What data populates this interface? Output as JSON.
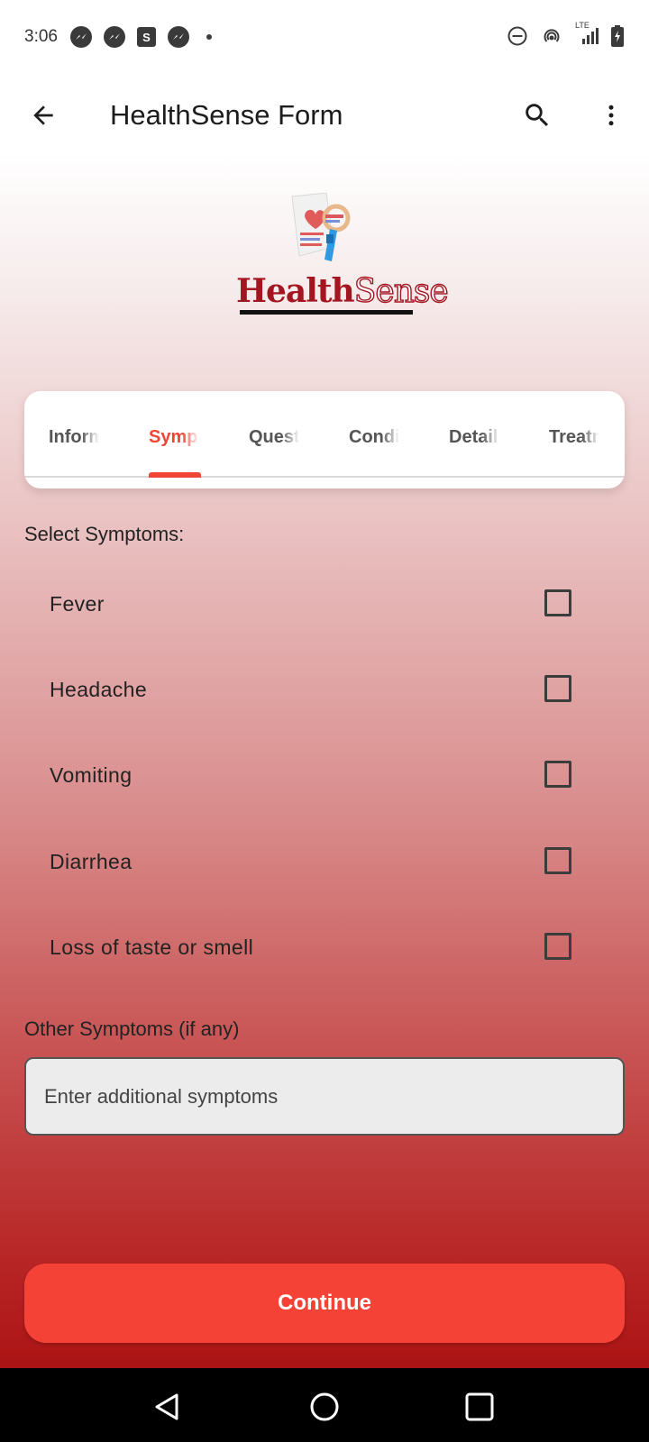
{
  "status_bar": {
    "time": "3:06",
    "left_icons": [
      "messenger-icon",
      "messenger-icon",
      "shopping-bag-icon",
      "messenger-icon",
      "dot-icon"
    ],
    "network_label": "LTE",
    "right_icons": [
      "do-not-disturb-icon",
      "hotspot-icon",
      "signal-icon",
      "battery-charging-icon"
    ]
  },
  "app_bar": {
    "title": "HealthSense Form",
    "back_icon": "arrow-back-icon",
    "search_icon": "search-icon",
    "menu_icon": "more-vert-icon"
  },
  "logo": {
    "word_part1": "Health",
    "word_part2": "Sense"
  },
  "tabs": {
    "items": [
      {
        "label": "Information",
        "active": false
      },
      {
        "label": "Symptoms",
        "active": true
      },
      {
        "label": "Questions",
        "active": false
      },
      {
        "label": "Conditions",
        "active": false
      },
      {
        "label": "Details",
        "active": false
      },
      {
        "label": "Treatment",
        "active": false
      }
    ]
  },
  "symptoms": {
    "heading": "Select Symptoms:",
    "items": [
      {
        "label": "Fever",
        "checked": false
      },
      {
        "label": "Headache",
        "checked": false
      },
      {
        "label": "Vomiting",
        "checked": false
      },
      {
        "label": "Diarrhea",
        "checked": false
      },
      {
        "label": "Loss of taste or smell",
        "checked": false
      }
    ]
  },
  "other_symptoms": {
    "label": "Other Symptoms (if any)",
    "placeholder": "Enter additional symptoms",
    "value": ""
  },
  "continue_label": "Continue",
  "colors": {
    "accent": "#f44336",
    "brand": "#a31521",
    "tab_active": "#ef4436"
  },
  "nav_bar": {
    "icons": [
      "back-triangle-icon",
      "home-circle-icon",
      "recents-square-icon"
    ]
  }
}
